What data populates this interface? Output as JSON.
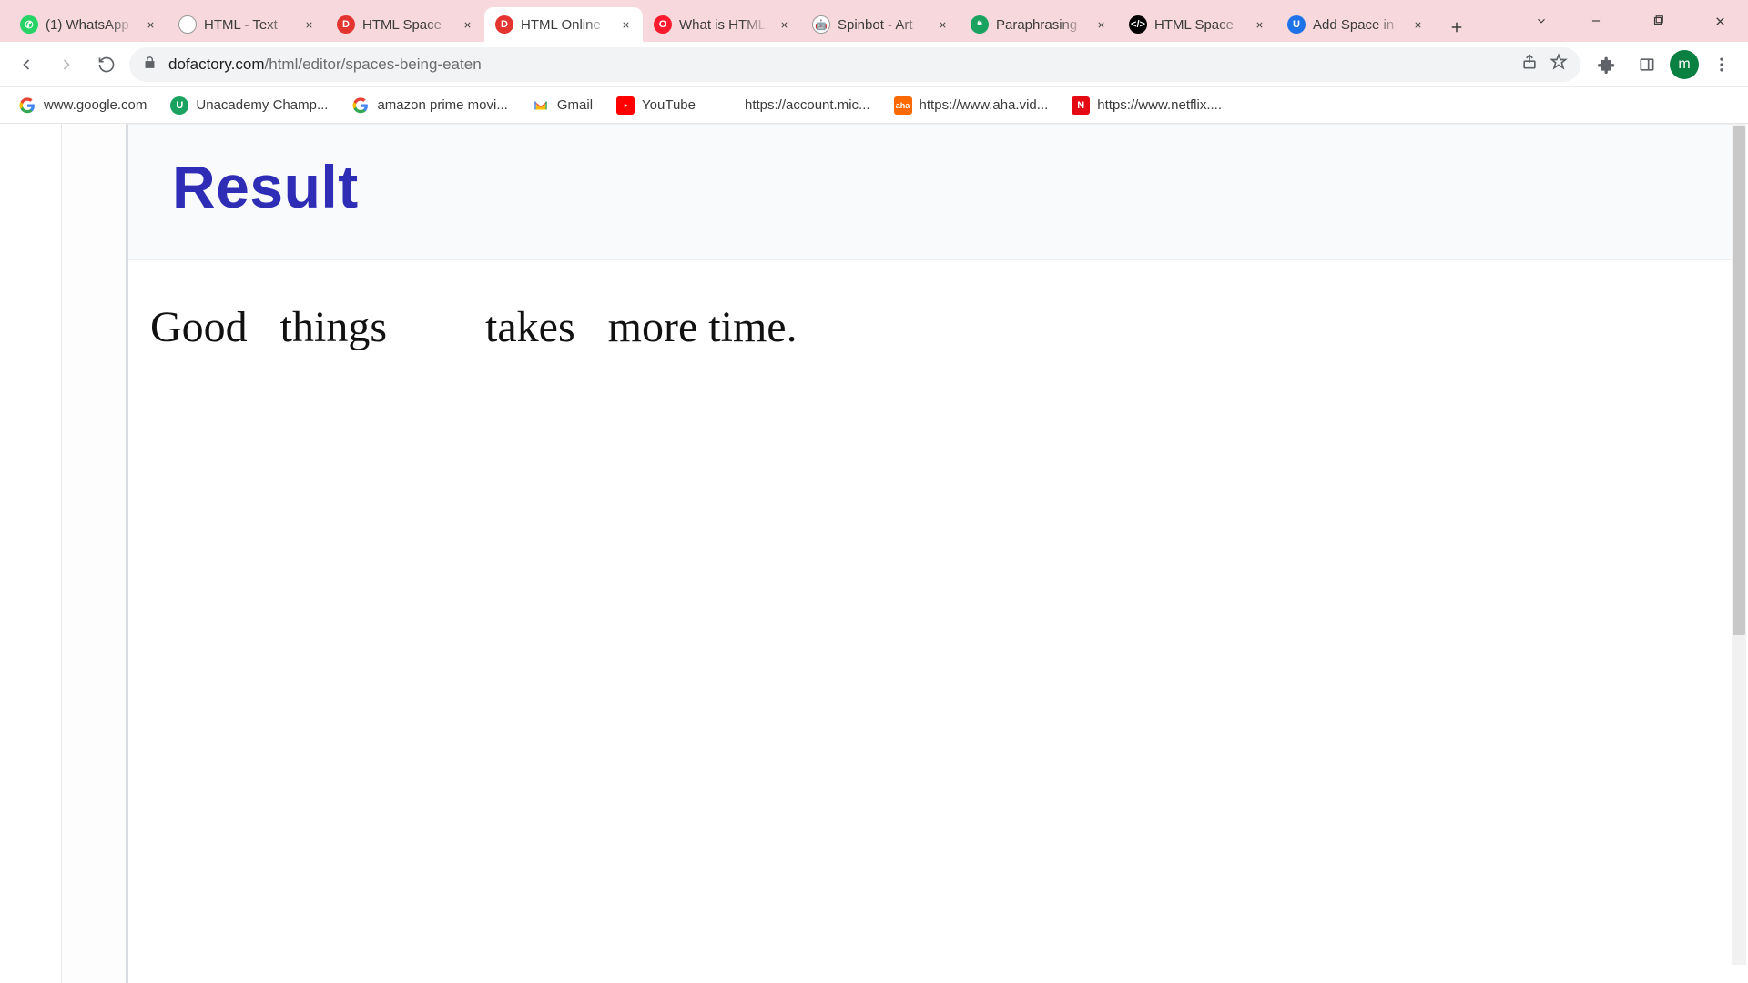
{
  "tabs": [
    {
      "title": "(1) WhatsApp",
      "favicon": "whatsapp"
    },
    {
      "title": "HTML - Text",
      "favicon": "edu"
    },
    {
      "title": "HTML Space",
      "favicon": "dofactory"
    },
    {
      "title": "HTML Online",
      "favicon": "dofactory",
      "active": true
    },
    {
      "title": "What is HTML",
      "favicon": "opera"
    },
    {
      "title": "Spinbot - Art",
      "favicon": "bot"
    },
    {
      "title": "Paraphrasing",
      "favicon": "para"
    },
    {
      "title": "HTML Space",
      "favicon": "cb"
    },
    {
      "title": "Add Space in",
      "favicon": "un"
    }
  ],
  "address": {
    "host": "dofactory.com",
    "path": "/html/editor/spaces-being-eaten"
  },
  "bookmarks": [
    {
      "label": "www.google.com",
      "icon": "google"
    },
    {
      "label": "Unacademy Champ...",
      "icon": "un"
    },
    {
      "label": "amazon prime movi...",
      "icon": "google"
    },
    {
      "label": "Gmail",
      "icon": "gmail"
    },
    {
      "label": "YouTube",
      "icon": "yt"
    },
    {
      "label": "https://account.mic...",
      "icon": "ms"
    },
    {
      "label": "https://www.aha.vid...",
      "icon": "aha"
    },
    {
      "label": "https://www.netflix....",
      "icon": "nflx"
    }
  ],
  "avatar_letter": "m",
  "page": {
    "result_heading": "Result",
    "result_text": "Good   things         takes   more time."
  }
}
